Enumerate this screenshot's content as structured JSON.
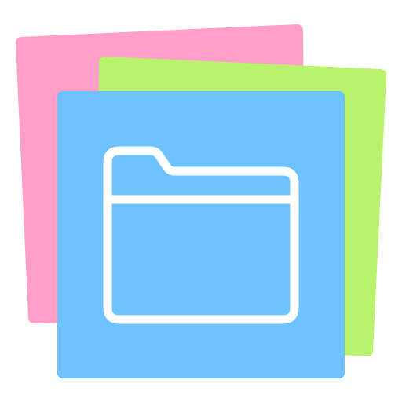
{
  "icon": {
    "name": "folder-icon",
    "colors": {
      "background": "#ffffff",
      "back_sheet": "#ff9fc9",
      "middle_sheet": "#b9f26c",
      "front_sheet": "#6ec3ff",
      "folder_stroke": "#ffffff"
    }
  }
}
